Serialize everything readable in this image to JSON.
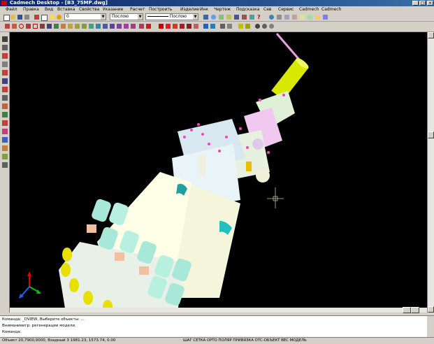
{
  "window": {
    "title": "Cadmech Desktop - [ВЗ_75МР.dwg]",
    "minimize": "_",
    "maximize": "□",
    "close": "×"
  },
  "menu": [
    "Файл",
    "Правка",
    "Вид",
    "Вставка",
    "Свойства",
    "Указание",
    "Расчет",
    "Построить",
    "Изделие",
    "Инк",
    "Чертеж",
    "Подсказка",
    "Сев",
    "Сервис",
    "Cadmech",
    "Cadmech"
  ],
  "toolbar": {
    "layer_value": "0",
    "color_value": "Послою",
    "linetype_value": "Послою",
    "dropdown_arrow": "▼"
  },
  "command_area": {
    "lines": [
      "Команда: _DVIEW, Выберите объекты: ...",
      "Вниманиеигр: регенерации модели.",
      "Команда:"
    ]
  },
  "status": {
    "coords": "Объект 20,7900,0000,   Взадный  3 1981.23, 1573.74, 0.00",
    "modes": "ШАГ  СЕТКА  ОРТО  ПОЛЯР  ПРИВЯЗКА  ОТС-ОБЪЕКТ  ВЕС  МОДЕЛЬ"
  },
  "colors": {
    "title_bar": "#0a246a",
    "canvas_background": "#000000",
    "ui_chrome": "#d4d0c8",
    "model_body": "#f5f5dc",
    "model_cyan": "#a8e8e0",
    "model_yellow": "#e8e800",
    "model_pink": "#f0b0e0"
  },
  "viewport_icons": [
    "ucs-axes-icon",
    "crosshair-cursor-icon"
  ]
}
